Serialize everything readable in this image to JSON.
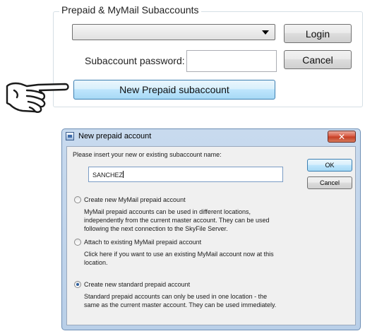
{
  "group": {
    "title": "Prepaid & MyMail Subaccounts",
    "combo_value": "",
    "login_label": "Login",
    "password_label": "Subaccount password:",
    "password_value": "",
    "cancel_label": "Cancel",
    "new_prepaid_label": "New Prepaid subaccount"
  },
  "icons": {
    "pointer": "pointing-hand-icon",
    "dialog": "window-icon",
    "close": "close-icon"
  },
  "dialog": {
    "title": "New prepaid account",
    "close_glyph": "✕",
    "prompt": "Please insert your new or existing subaccount name:",
    "name_value": "SANCHEZ",
    "ok_label": "OK",
    "cancel_label": "Cancel",
    "options": [
      {
        "label": "Create new MyMail prepaid account",
        "lines": [
          "MyMail prepaid accounts can be used in different locations,",
          "independently from the current master account. They can be used",
          "following the next connection to the SkyFile Server."
        ],
        "checked": false
      },
      {
        "label": "Attach to existing MyMail prepaid account",
        "lines": [
          "Click here if you want to use an existing MyMail account now at this",
          "location."
        ],
        "checked": false
      },
      {
        "label": "Create new standard prepaid account",
        "lines": [
          "Standard prepaid accounts can only be used in one location - the",
          "same as the current master account. They can be used immediately."
        ],
        "checked": true
      }
    ]
  },
  "colors": {
    "dialog_frame": "#b9cfe8",
    "close_button": "#c43c22",
    "highlight_button": "#bee6fd"
  }
}
